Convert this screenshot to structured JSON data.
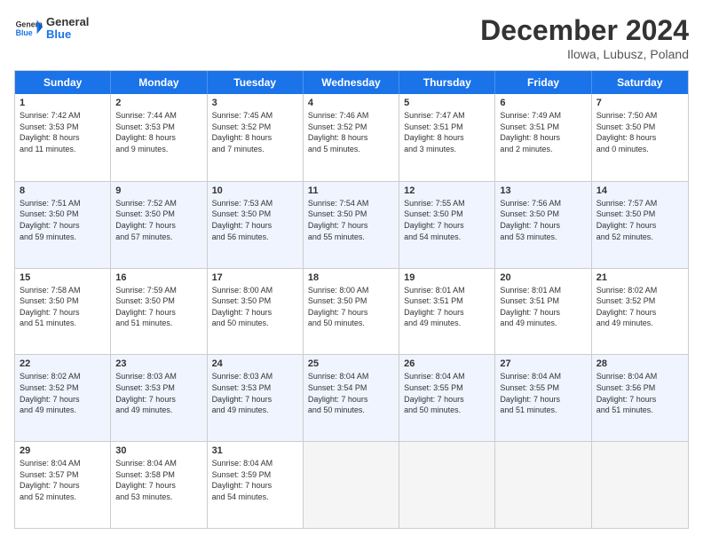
{
  "header": {
    "logo_general": "General",
    "logo_blue": "Blue",
    "month_title": "December 2024",
    "subtitle": "Ilowa, Lubusz, Poland"
  },
  "day_headers": [
    "Sunday",
    "Monday",
    "Tuesday",
    "Wednesday",
    "Thursday",
    "Friday",
    "Saturday"
  ],
  "weeks": [
    {
      "alt": false,
      "days": [
        {
          "num": "1",
          "info": "Sunrise: 7:42 AM\nSunset: 3:53 PM\nDaylight: 8 hours\nand 11 minutes."
        },
        {
          "num": "2",
          "info": "Sunrise: 7:44 AM\nSunset: 3:53 PM\nDaylight: 8 hours\nand 9 minutes."
        },
        {
          "num": "3",
          "info": "Sunrise: 7:45 AM\nSunset: 3:52 PM\nDaylight: 8 hours\nand 7 minutes."
        },
        {
          "num": "4",
          "info": "Sunrise: 7:46 AM\nSunset: 3:52 PM\nDaylight: 8 hours\nand 5 minutes."
        },
        {
          "num": "5",
          "info": "Sunrise: 7:47 AM\nSunset: 3:51 PM\nDaylight: 8 hours\nand 3 minutes."
        },
        {
          "num": "6",
          "info": "Sunrise: 7:49 AM\nSunset: 3:51 PM\nDaylight: 8 hours\nand 2 minutes."
        },
        {
          "num": "7",
          "info": "Sunrise: 7:50 AM\nSunset: 3:50 PM\nDaylight: 8 hours\nand 0 minutes."
        }
      ]
    },
    {
      "alt": true,
      "days": [
        {
          "num": "8",
          "info": "Sunrise: 7:51 AM\nSunset: 3:50 PM\nDaylight: 7 hours\nand 59 minutes."
        },
        {
          "num": "9",
          "info": "Sunrise: 7:52 AM\nSunset: 3:50 PM\nDaylight: 7 hours\nand 57 minutes."
        },
        {
          "num": "10",
          "info": "Sunrise: 7:53 AM\nSunset: 3:50 PM\nDaylight: 7 hours\nand 56 minutes."
        },
        {
          "num": "11",
          "info": "Sunrise: 7:54 AM\nSunset: 3:50 PM\nDaylight: 7 hours\nand 55 minutes."
        },
        {
          "num": "12",
          "info": "Sunrise: 7:55 AM\nSunset: 3:50 PM\nDaylight: 7 hours\nand 54 minutes."
        },
        {
          "num": "13",
          "info": "Sunrise: 7:56 AM\nSunset: 3:50 PM\nDaylight: 7 hours\nand 53 minutes."
        },
        {
          "num": "14",
          "info": "Sunrise: 7:57 AM\nSunset: 3:50 PM\nDaylight: 7 hours\nand 52 minutes."
        }
      ]
    },
    {
      "alt": false,
      "days": [
        {
          "num": "15",
          "info": "Sunrise: 7:58 AM\nSunset: 3:50 PM\nDaylight: 7 hours\nand 51 minutes."
        },
        {
          "num": "16",
          "info": "Sunrise: 7:59 AM\nSunset: 3:50 PM\nDaylight: 7 hours\nand 51 minutes."
        },
        {
          "num": "17",
          "info": "Sunrise: 8:00 AM\nSunset: 3:50 PM\nDaylight: 7 hours\nand 50 minutes."
        },
        {
          "num": "18",
          "info": "Sunrise: 8:00 AM\nSunset: 3:50 PM\nDaylight: 7 hours\nand 50 minutes."
        },
        {
          "num": "19",
          "info": "Sunrise: 8:01 AM\nSunset: 3:51 PM\nDaylight: 7 hours\nand 49 minutes."
        },
        {
          "num": "20",
          "info": "Sunrise: 8:01 AM\nSunset: 3:51 PM\nDaylight: 7 hours\nand 49 minutes."
        },
        {
          "num": "21",
          "info": "Sunrise: 8:02 AM\nSunset: 3:52 PM\nDaylight: 7 hours\nand 49 minutes."
        }
      ]
    },
    {
      "alt": true,
      "days": [
        {
          "num": "22",
          "info": "Sunrise: 8:02 AM\nSunset: 3:52 PM\nDaylight: 7 hours\nand 49 minutes."
        },
        {
          "num": "23",
          "info": "Sunrise: 8:03 AM\nSunset: 3:53 PM\nDaylight: 7 hours\nand 49 minutes."
        },
        {
          "num": "24",
          "info": "Sunrise: 8:03 AM\nSunset: 3:53 PM\nDaylight: 7 hours\nand 49 minutes."
        },
        {
          "num": "25",
          "info": "Sunrise: 8:04 AM\nSunset: 3:54 PM\nDaylight: 7 hours\nand 50 minutes."
        },
        {
          "num": "26",
          "info": "Sunrise: 8:04 AM\nSunset: 3:55 PM\nDaylight: 7 hours\nand 50 minutes."
        },
        {
          "num": "27",
          "info": "Sunrise: 8:04 AM\nSunset: 3:55 PM\nDaylight: 7 hours\nand 51 minutes."
        },
        {
          "num": "28",
          "info": "Sunrise: 8:04 AM\nSunset: 3:56 PM\nDaylight: 7 hours\nand 51 minutes."
        }
      ]
    },
    {
      "alt": false,
      "days": [
        {
          "num": "29",
          "info": "Sunrise: 8:04 AM\nSunset: 3:57 PM\nDaylight: 7 hours\nand 52 minutes."
        },
        {
          "num": "30",
          "info": "Sunrise: 8:04 AM\nSunset: 3:58 PM\nDaylight: 7 hours\nand 53 minutes."
        },
        {
          "num": "31",
          "info": "Sunrise: 8:04 AM\nSunset: 3:59 PM\nDaylight: 7 hours\nand 54 minutes."
        },
        {
          "num": "",
          "info": ""
        },
        {
          "num": "",
          "info": ""
        },
        {
          "num": "",
          "info": ""
        },
        {
          "num": "",
          "info": ""
        }
      ]
    }
  ]
}
